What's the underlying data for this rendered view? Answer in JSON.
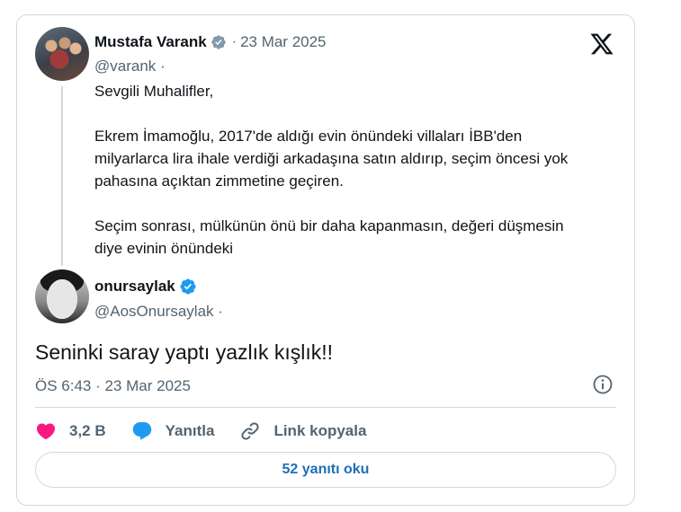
{
  "parent": {
    "name": "Mustafa Varank",
    "separator": "·",
    "date": "23 Mar 2025",
    "handle": "@varank ·",
    "body": [
      "Sevgili Muhalifler,",
      "",
      "Ekrem İmamoğlu, 2017'de aldığı evin önündeki villaları İBB'den",
      "milyarlarca lira ihale verdiği arkadaşına satın aldırıp, seçim öncesi yok",
      "pahasına açıktan zimmetine geçiren.",
      "",
      "Seçim sonrası, mülkünün önü bir daha kapanmasın, değeri düşmesin",
      "diye evinin önündeki"
    ]
  },
  "reply": {
    "name": "onursaylak",
    "handle": "@AosOnursaylak ·",
    "text": "Seninki saray yaptı yazlık kışlık!!",
    "time": "ÖS 6:43 · 23 Mar 2025"
  },
  "actions": {
    "likes": "3,2 B",
    "reply_label": "Yanıtla",
    "copy_link_label": "Link kopyala"
  },
  "replies_button": "52 yanıtı oku",
  "colors": {
    "verified_grey": "#829aab",
    "verified_blue": "#1d9bf0",
    "like": "#f91880",
    "reply_icon": "#1d9bf0",
    "link_blue": "#1d6fb8"
  },
  "icons": [
    "x-logo-icon",
    "verified-badge-icon",
    "info-icon",
    "heart-icon",
    "reply-bubble-icon",
    "link-icon"
  ]
}
